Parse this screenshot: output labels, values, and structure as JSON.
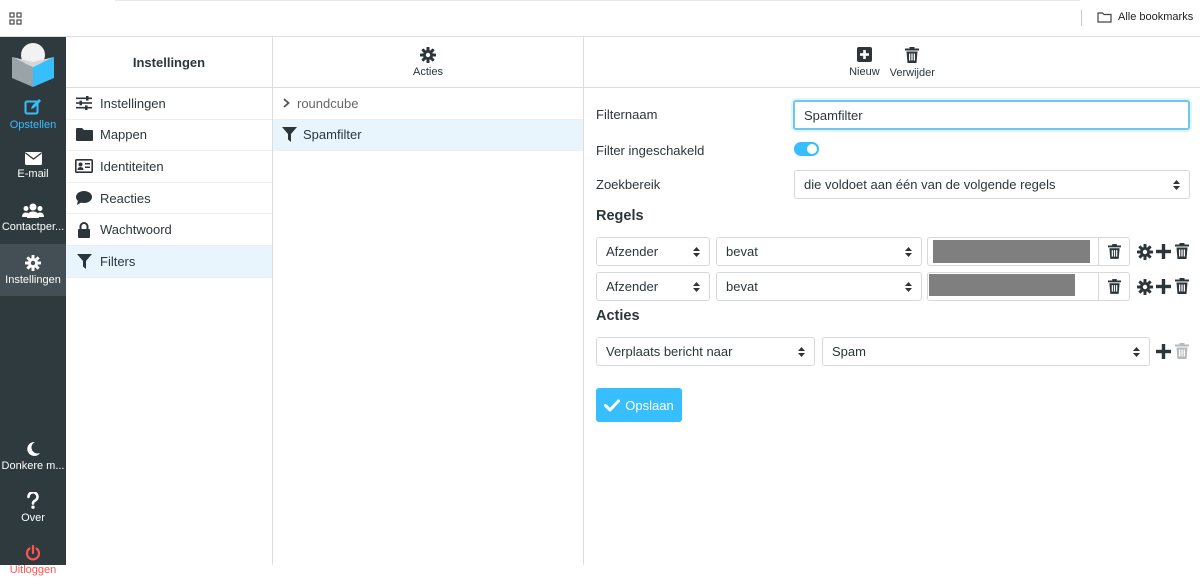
{
  "browser": {
    "bookmarks_label": "Alle bookmarks"
  },
  "nav": {
    "compose": "Opstellen",
    "mail": "E-mail",
    "contacts": "Contactper...",
    "settings": "Instellingen",
    "darkmode": "Donkere m...",
    "about": "Over",
    "logout": "Uitloggen"
  },
  "sidebar": {
    "title": "Instellingen",
    "items": [
      {
        "label": "Instellingen",
        "icon": "sliders-icon"
      },
      {
        "label": "Mappen",
        "icon": "folder-icon"
      },
      {
        "label": "Identiteiten",
        "icon": "id-card-icon"
      },
      {
        "label": "Reacties",
        "icon": "comment-icon"
      },
      {
        "label": "Wachtwoord",
        "icon": "lock-icon"
      },
      {
        "label": "Filters",
        "icon": "filter-icon"
      }
    ]
  },
  "filter_list": {
    "actions_label": "Acties",
    "set_name": "roundcube",
    "filter_name": "Spamfilter"
  },
  "toolbar": {
    "new_label": "Nieuw",
    "delete_label": "Verwijder"
  },
  "form": {
    "name_label": "Filternaam",
    "name_value": "Spamfilter",
    "enabled_label": "Filter ingeschakeld",
    "enabled": true,
    "scope_label": "Zoekbereik",
    "scope_value": "die voldoet aan één van de volgende regels",
    "rules_heading": "Regels",
    "rules": [
      {
        "header": "Afzender",
        "operator": "bevat"
      },
      {
        "header": "Afzender",
        "operator": "bevat"
      }
    ],
    "actions_heading": "Acties",
    "action_type": "Verplaats bericht naar",
    "action_target": "Spam",
    "save_label": "Opslaan"
  },
  "colors": {
    "accent": "#37beff",
    "sidebar_bg": "#2f3a3f",
    "selected_bg": "#e9f5fd",
    "logout": "#ff5552"
  }
}
